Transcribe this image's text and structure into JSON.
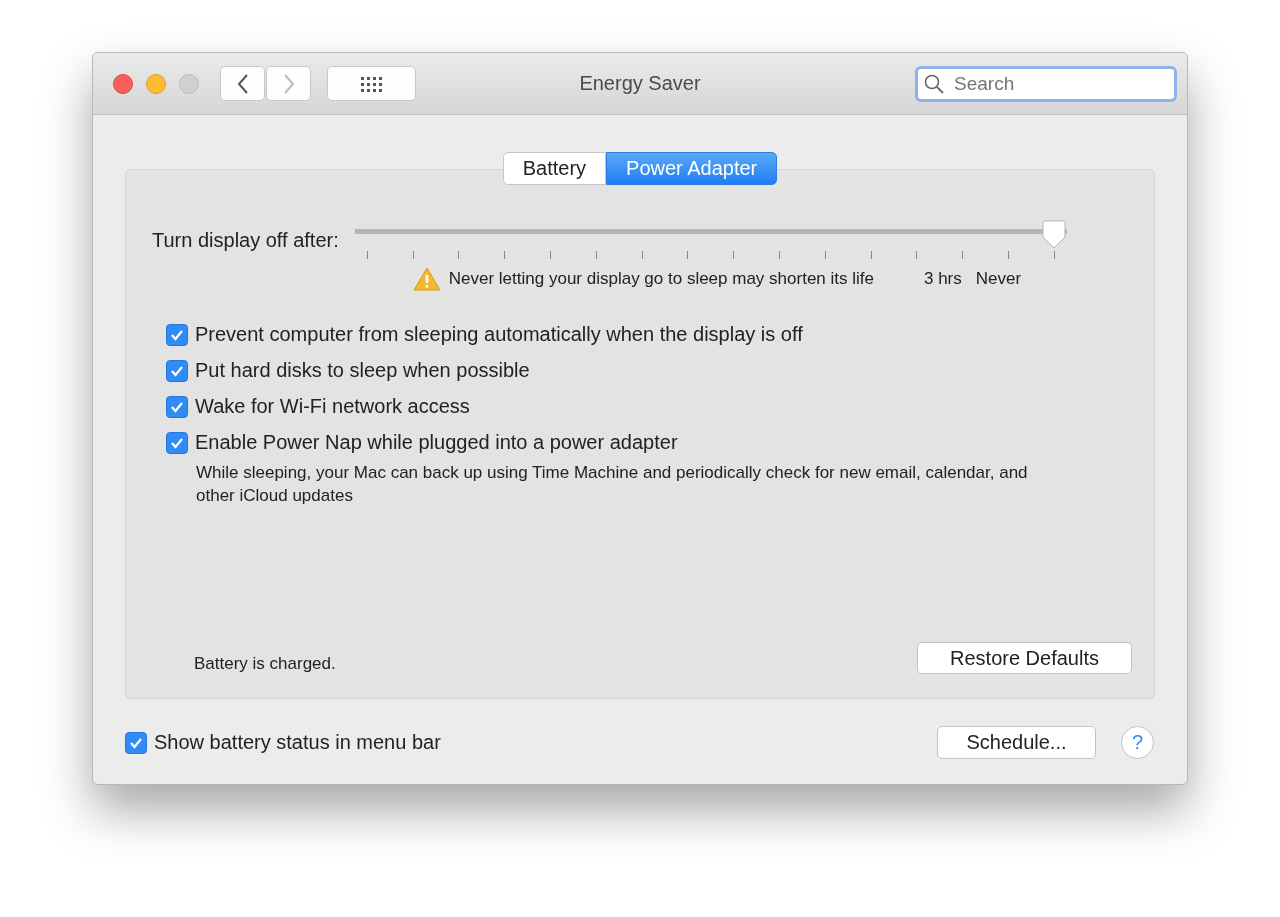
{
  "window": {
    "title": "Energy Saver"
  },
  "search": {
    "placeholder": "Search"
  },
  "tabs": [
    {
      "label": "Battery",
      "selected": false
    },
    {
      "label": "Power Adapter",
      "selected": true
    }
  ],
  "display_slider": {
    "label": "Turn display off after:",
    "level": 1,
    "warning": "Never letting your display go to sleep may shorten its life",
    "tick_labels": [
      "3 hrs",
      "Never"
    ]
  },
  "options": [
    {
      "label": "Prevent computer from sleeping automatically when the display is off",
      "checked": true
    },
    {
      "label": "Put hard disks to sleep when possible",
      "checked": true
    },
    {
      "label": "Wake for Wi-Fi network access",
      "checked": true
    },
    {
      "label": "Enable Power Nap while plugged into a power adapter",
      "checked": true,
      "description": "While sleeping, your Mac can back up using Time Machine and periodically check for new email, calendar, and other iCloud updates"
    }
  ],
  "battery_status": "Battery is charged.",
  "restore_button": "Restore Defaults",
  "menu_bar_option": {
    "label": "Show battery status in menu bar",
    "checked": true
  },
  "schedule_button": "Schedule...",
  "help_button": "?"
}
